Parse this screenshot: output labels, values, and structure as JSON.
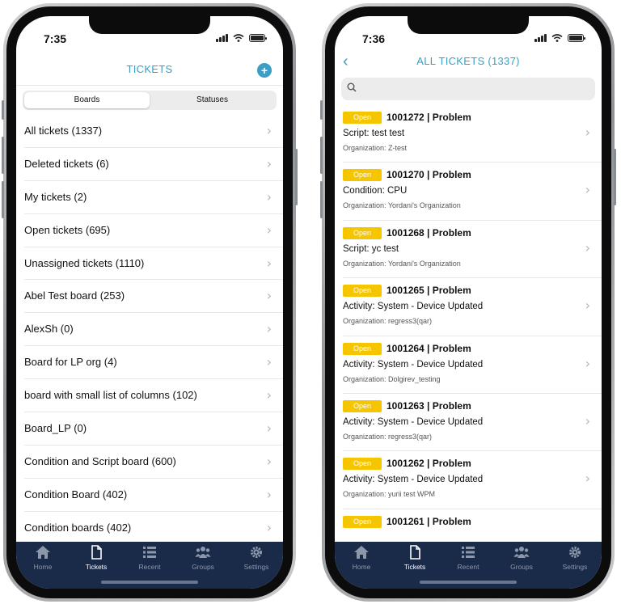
{
  "status_bar": {
    "left_time": "7:35",
    "right_time": "7:36"
  },
  "boards_screen": {
    "title": "TICKETS",
    "add_label": "+",
    "segments": [
      "Boards",
      "Statuses"
    ],
    "boards": [
      "All tickets (1337)",
      "Deleted tickets (6)",
      "My tickets (2)",
      "Open tickets (695)",
      "Unassigned tickets (1110)",
      "Abel Test board (253)",
      "AlexSh (0)",
      "Board for LP org (4)",
      "board with small list of columns (102)",
      "Board_LP (0)",
      "Condition and Script board (600)",
      "Condition Board (402)",
      "Condition boards (402)"
    ]
  },
  "tickets_screen": {
    "title": "ALL TICKETS (1337)",
    "back_label": "‹",
    "search": {
      "value": "",
      "placeholder": ""
    },
    "tickets": [
      {
        "status": "Open",
        "id_type": "1001272 | Problem",
        "subject": "Script: test test",
        "org": "Organization: Z-test"
      },
      {
        "status": "Open",
        "id_type": "1001270 | Problem",
        "subject": "Condition: CPU",
        "org": "Organization: Yordani's Organization"
      },
      {
        "status": "Open",
        "id_type": "1001268 | Problem",
        "subject": "Script: yc test",
        "org": "Organization: Yordani's Organization"
      },
      {
        "status": "Open",
        "id_type": "1001265 | Problem",
        "subject": "Activity: System - Device Updated",
        "org": "Organization: regress3(qar)"
      },
      {
        "status": "Open",
        "id_type": "1001264 | Problem",
        "subject": "Activity: System - Device Updated",
        "org": "Organization: Dolgirev_testing"
      },
      {
        "status": "Open",
        "id_type": "1001263 | Problem",
        "subject": "Activity: System - Device Updated",
        "org": "Organization: regress3(qar)"
      },
      {
        "status": "Open",
        "id_type": "1001262 | Problem",
        "subject": "Activity: System - Device Updated",
        "org": "Organization: yurii test WPM"
      },
      {
        "status": "Open",
        "id_type": "1001261 | Problem",
        "subject": "",
        "org": ""
      }
    ]
  },
  "tab_bar": {
    "tabs": [
      {
        "label": "Home",
        "icon": "home-icon"
      },
      {
        "label": "Tickets",
        "icon": "tickets-icon"
      },
      {
        "label": "Recent",
        "icon": "recent-icon"
      },
      {
        "label": "Groups",
        "icon": "groups-icon"
      },
      {
        "label": "Settings",
        "icon": "settings-icon"
      }
    ],
    "active_tab": "Tickets"
  },
  "colors": {
    "accent": "#3a9ec6",
    "tab_bar_bg": "#1a2b4a",
    "status_open": "#f5c500",
    "tab_inactive": "#8c97aa"
  }
}
